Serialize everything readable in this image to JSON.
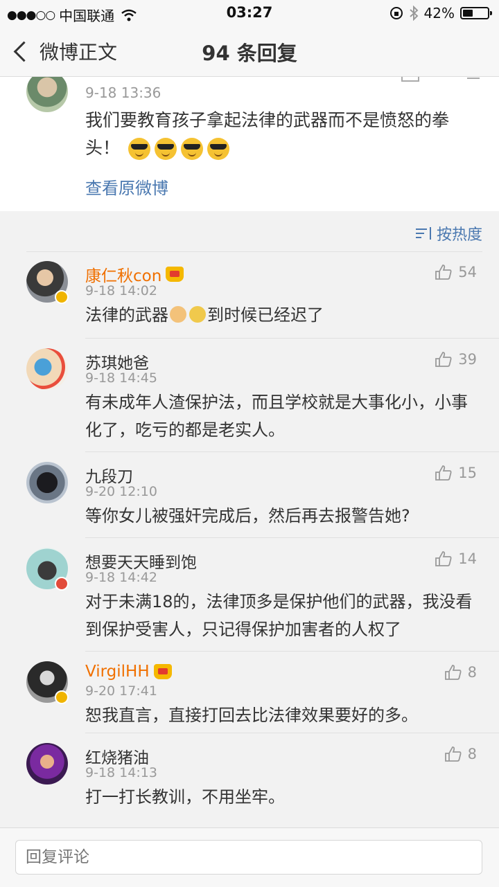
{
  "status_bar": {
    "signal": "●●●○○",
    "carrier": "中国联通",
    "time": "03:27",
    "battery_text": "42%",
    "battery_level": 0.42
  },
  "nav": {
    "back_label": "微博正文",
    "title": "94 条回复"
  },
  "post": {
    "time": "9-18 13:36",
    "text": "我们要教育孩子拿起法律的武器而不是愤怒的拳头！",
    "view_original": "查看原微博"
  },
  "sort": {
    "label": "按热度"
  },
  "comments": [
    {
      "name": "康仁秋con",
      "vip": true,
      "time": "9-18 14:02",
      "text": "法律的武器",
      "text_after": "到时候已经迟了",
      "likes": "54"
    },
    {
      "name": "苏琪她爸",
      "vip": false,
      "time": "9-18 14:45",
      "text": "有未成年人渣保护法，而且学校就是大事化小，小事化了，吃亏的都是老实人。",
      "likes": "39"
    },
    {
      "name": "九段刀",
      "vip": false,
      "time": "9-20 12:10",
      "text": "等你女儿被强奸完成后，然后再去报警告她?",
      "likes": "15"
    },
    {
      "name": "想要天天睡到饱",
      "vip": false,
      "time": "9-18 14:42",
      "text": "对于未满18的，法律顶多是保护他们的武器，我没看到保护受害人，只记得保护加害者的人权了",
      "likes": "14"
    },
    {
      "name": "VirgilHH",
      "vip": true,
      "time": "9-20 17:41",
      "text": "恕我直言，直接打回去比法律效果要好的多。",
      "likes": "8"
    },
    {
      "name": "红烧猪油",
      "vip": false,
      "time": "9-18 14:13",
      "text": "打一打长教训，不用坐牢。",
      "likes": "8"
    }
  ],
  "reply": {
    "placeholder": "回复评论"
  }
}
